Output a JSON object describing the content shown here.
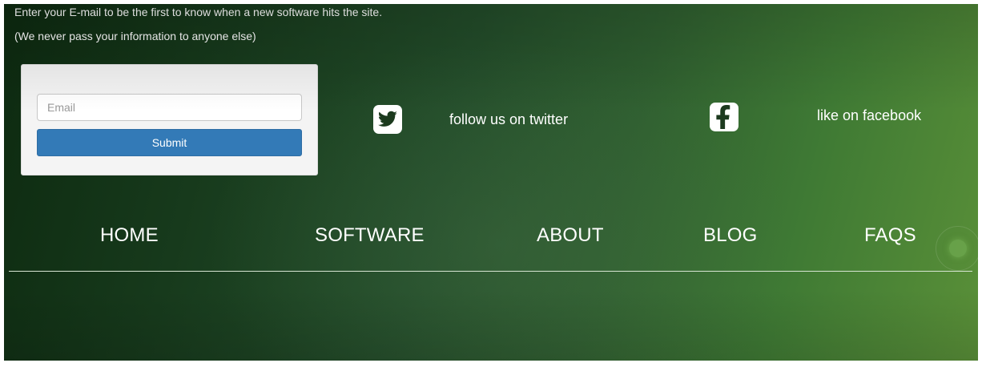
{
  "newsletter": {
    "intro_line": "Enter your E-mail to be the first to know when a new software hits the site.",
    "privacy_line": "(We never pass your information to anyone else)",
    "email_placeholder": "Email",
    "email_value": "",
    "submit_label": "Submit"
  },
  "social": {
    "twitter_label": "follow us on twitter",
    "twitter_icon": "twitter-bird-icon",
    "facebook_label": "like on facebook",
    "facebook_icon": "facebook-f-icon"
  },
  "nav": {
    "items": [
      {
        "label": "HOME"
      },
      {
        "label": "SOFTWARE"
      },
      {
        "label": "ABOUT"
      },
      {
        "label": "BLOG"
      },
      {
        "label": "FAQS"
      }
    ]
  },
  "colors": {
    "background_dark": "#0d2a10",
    "background_light": "#5a9038",
    "submit_button": "#337ab7",
    "text": "#ffffff"
  }
}
